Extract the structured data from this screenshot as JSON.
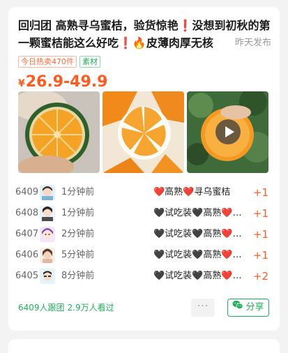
{
  "post": {
    "title": "回归团 高熟寻乌蜜桔，验货惊艳❗没想到初秋的第一颗蜜桔能这么好吃❗🔥皮薄肉厚无核",
    "posted_time": "昨天发布",
    "tags": [
      "今日热卖470件",
      "素材"
    ],
    "price_currency": "¥",
    "price_range": "26.9-49.9"
  },
  "photos": [
    {
      "name": "orange-half-photo",
      "has_play": false
    },
    {
      "name": "orange-peeled-photo",
      "has_play": false
    },
    {
      "name": "orange-video-thumb",
      "has_play": true
    }
  ],
  "orders": [
    {
      "num": "6409",
      "time": "1分钟前",
      "item": "❤️高熟❤️寻乌蜜桔",
      "qty": "+1",
      "avatar": "girl"
    },
    {
      "num": "6408",
      "time": "1分钟前",
      "item": "🖤试吃装🖤高熟❤️寻乌蜜桔",
      "qty": "+1",
      "avatar": "girl2"
    },
    {
      "num": "6407",
      "time": "2分钟前",
      "item": "🖤试吃装🖤高熟❤️寻乌蜜桔",
      "qty": "+1",
      "avatar": "cartoon"
    },
    {
      "num": "6406",
      "time": "5分钟前",
      "item": "🖤试吃装🖤高熟❤️寻乌蜜桔",
      "qty": "+1",
      "avatar": "woman"
    },
    {
      "num": "6405",
      "time": "8分钟前",
      "item": "🖤试吃装🖤高熟❤️寻乌蜜桔",
      "qty": "+2",
      "avatar": "boy"
    }
  ],
  "footer": {
    "followers": "6409人跟团",
    "views": "2.9万人看过",
    "more_label": "···",
    "share_label": "分享"
  },
  "colors": {
    "accent_orange": "#ff5a1f",
    "accent_green": "#20b05a",
    "background": "#f3f3f3"
  }
}
